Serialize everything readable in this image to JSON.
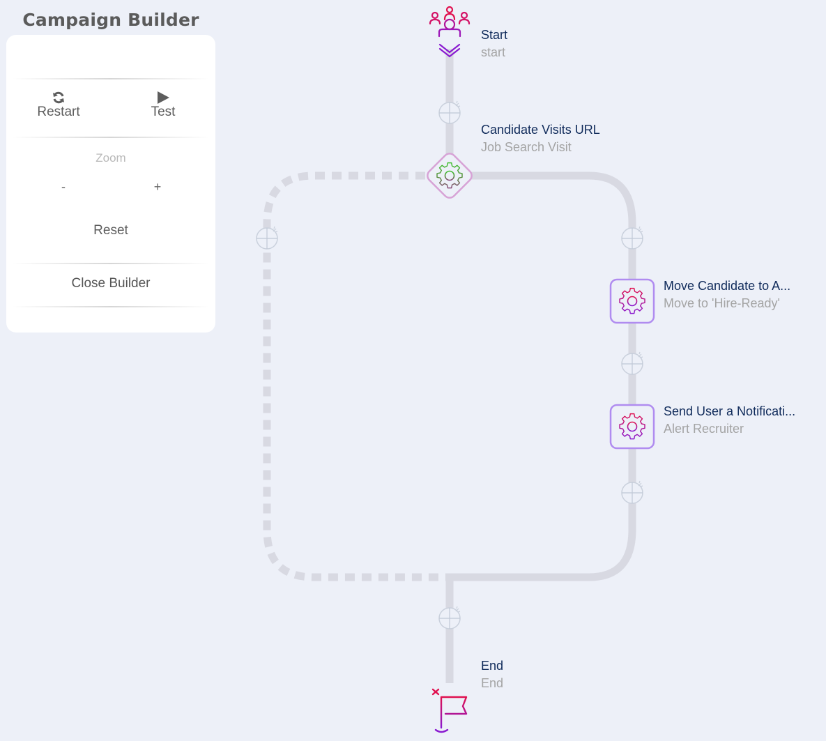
{
  "panel": {
    "title": "Campaign Builder",
    "restart": {
      "label": "Restart",
      "icon": "refresh-icon"
    },
    "test": {
      "label": "Test",
      "icon": "play-icon"
    },
    "zoom": {
      "label": "Zoom",
      "minus": "-",
      "plus": "+"
    },
    "reset_label": "Reset",
    "close_label": "Close Builder"
  },
  "flow": {
    "start": {
      "title": "Start",
      "subtitle": "start",
      "icon": "audience-icon"
    },
    "trigger": {
      "title": "Candidate Visits URL",
      "subtitle": "Job Search Visit",
      "icon": "gear-icon"
    },
    "action1": {
      "title": "Move Candidate to A...",
      "subtitle": "Move to 'Hire-Ready'",
      "icon": "gear-icon"
    },
    "action2": {
      "title": "Send User a Notificati...",
      "subtitle": "Alert Recruiter",
      "icon": "gear-icon"
    },
    "end": {
      "title": "End",
      "subtitle": "End",
      "icon": "flag-icon"
    }
  },
  "colors": {
    "background": "#edf0f8",
    "path": "#d8d9e2",
    "title_text": "#0f2a5a",
    "subtitle_text": "#a4a4a4",
    "action_border": "#b08cf0",
    "trigger_border": "#d7a3d6",
    "trigger_gear": "#4ab53c",
    "gradient_start": "#e0104f",
    "gradient_end": "#8a1ad0"
  }
}
